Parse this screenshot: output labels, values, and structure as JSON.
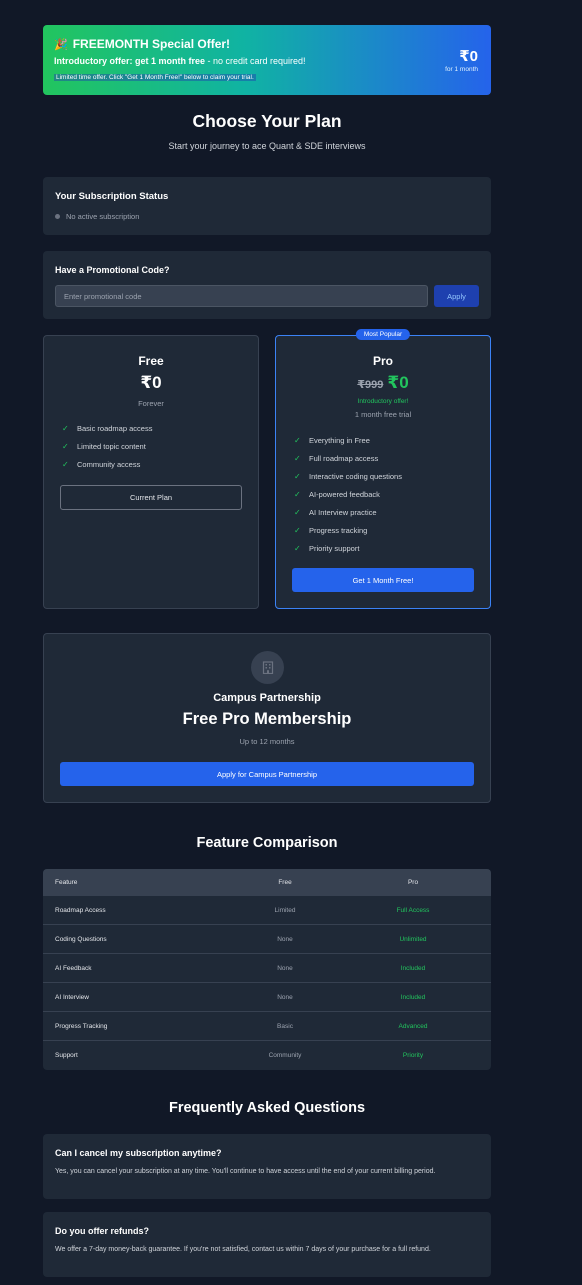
{
  "promo": {
    "icon": "confetti-icon",
    "title": "FREEMONTH Special Offer!",
    "subtitle_bold": "Introductory offer: get 1 month free",
    "subtitle_rest": " - no credit card required!",
    "note": "Limited time offer. Click \"Get 1 Month Free!\" below to claim your trial.",
    "price": "₹0",
    "price_period": "for 1 month"
  },
  "header": {
    "title": "Choose Your Plan",
    "subtitle": "Start your journey to ace Quant & SDE interviews"
  },
  "subscription": {
    "title": "Your Subscription Status",
    "status": "No active subscription"
  },
  "promo_code": {
    "title": "Have a Promotional Code?",
    "placeholder": "Enter promotional code",
    "apply_label": "Apply"
  },
  "plans": {
    "free": {
      "name": "Free",
      "price": "₹0",
      "period": "Forever",
      "features": [
        "Basic roadmap access",
        "Limited topic content",
        "Community access"
      ],
      "button": "Current Plan"
    },
    "pro": {
      "badge": "Most Popular",
      "name": "Pro",
      "old_price": "₹999",
      "price": "₹0",
      "intro": "Introductory offer!",
      "trial": "1 month free trial",
      "features": [
        "Everything in Free",
        "Full roadmap access",
        "Interactive coding questions",
        "AI-powered feedback",
        "AI Interview practice",
        "Progress tracking",
        "Priority support"
      ],
      "button": "Get 1 Month Free!"
    }
  },
  "campus": {
    "icon": "building-icon",
    "subtitle": "Campus Partnership",
    "title": "Free Pro Membership",
    "note": "Up to 12 months",
    "button": "Apply for Campus Partnership"
  },
  "comparison": {
    "title": "Feature Comparison",
    "headers": [
      "Feature",
      "Free",
      "Pro"
    ],
    "rows": [
      [
        "Roadmap Access",
        "Limited",
        "Full Access"
      ],
      [
        "Coding Questions",
        "None",
        "Unlimited"
      ],
      [
        "AI Feedback",
        "None",
        "Included"
      ],
      [
        "AI Interview",
        "None",
        "Included"
      ],
      [
        "Progress Tracking",
        "Basic",
        "Advanced"
      ],
      [
        "Support",
        "Community",
        "Priority"
      ]
    ]
  },
  "faq": {
    "title": "Frequently Asked Questions",
    "items": [
      {
        "q": "Can I cancel my subscription anytime?",
        "a": "Yes, you can cancel your subscription at any time. You'll continue to have access until the end of your current billing period."
      },
      {
        "q": "Do you offer refunds?",
        "a": "We offer a 7-day money-back guarantee. If you're not satisfied, contact us within 7 days of your purchase for a full refund."
      }
    ]
  },
  "colors": {
    "background": "#111827",
    "card": "#1f2937",
    "accent": "#2563eb",
    "success": "#22c55e"
  }
}
